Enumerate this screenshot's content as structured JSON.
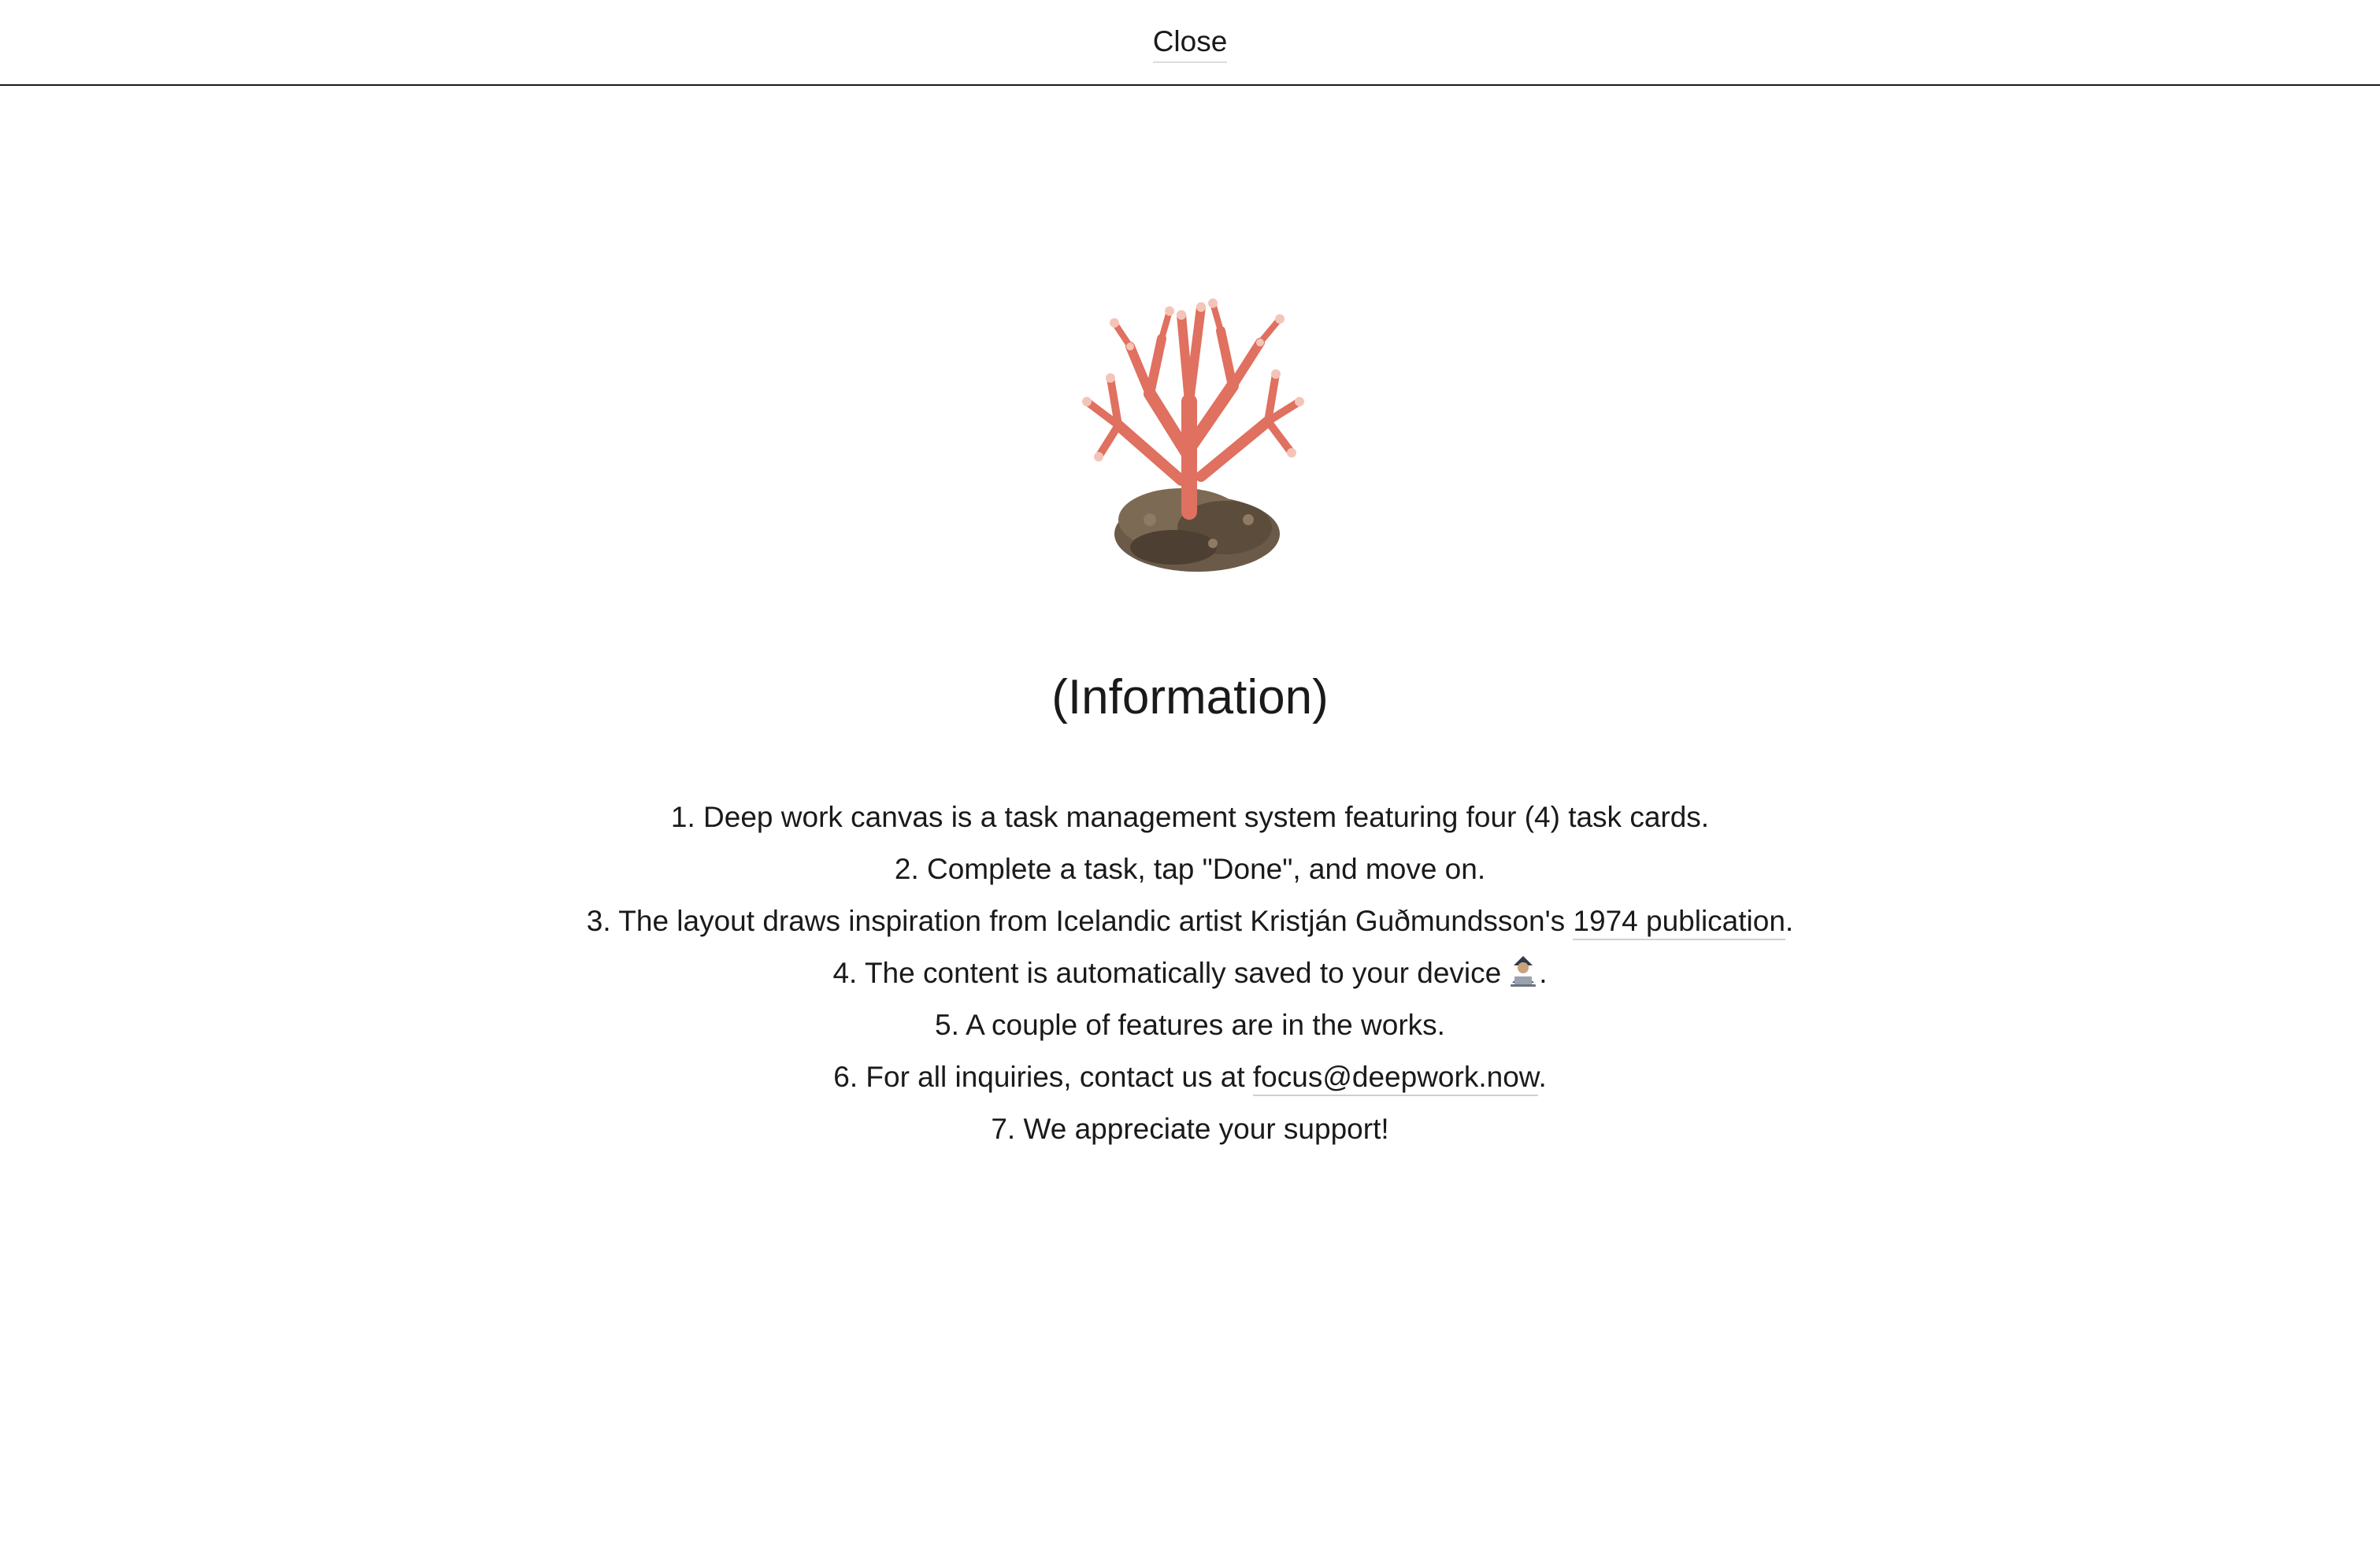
{
  "header": {
    "close_label": "Close"
  },
  "hero": {
    "icon": "coral-icon"
  },
  "title": "(Information)",
  "items": [
    {
      "text": "1. Deep work canvas is a task management system featuring four (4) task cards."
    },
    {
      "text": "2. Complete a task, tap \"Done\", and move on."
    },
    {
      "prefix": "3. The layout draws inspiration from Icelandic artist Kristján Guðmundsson's ",
      "link": "1974 publication",
      "suffix": "."
    },
    {
      "prefix": "4. The content is automatically saved to your device",
      "icon": "person-with-laptop-icon",
      "suffix": "."
    },
    {
      "text": "5. A couple of features are in the works."
    },
    {
      "prefix": "6. For all inquiries, contact us at ",
      "link": "focus@deepwork.now",
      "suffix": "."
    },
    {
      "text": "7. We appreciate your support!"
    }
  ],
  "colors": {
    "text": "#1a1a1a",
    "coral": "#e0705f",
    "rock": "#6b5a48"
  }
}
